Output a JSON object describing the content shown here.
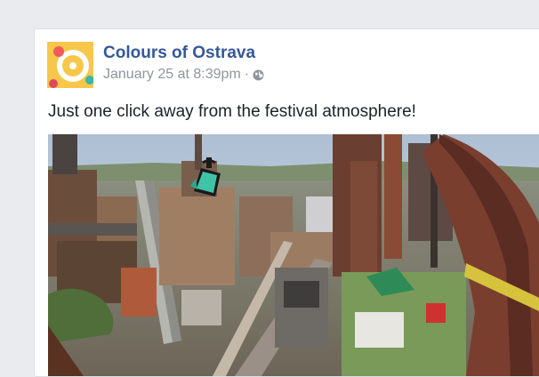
{
  "post": {
    "page_name": "Colours of Ostrava",
    "timestamp": "January 25 at 8:39pm",
    "separator": "·",
    "privacy_icon": "globe-icon",
    "text": "Just one click away from the festival atmosphere!",
    "photo_icon": "paint-bucket-icon"
  },
  "colors": {
    "link": "#365899",
    "meta": "#90949c",
    "text": "#1d2129",
    "avatar_bg": "#f6c74a",
    "background": "#e9ebee"
  }
}
